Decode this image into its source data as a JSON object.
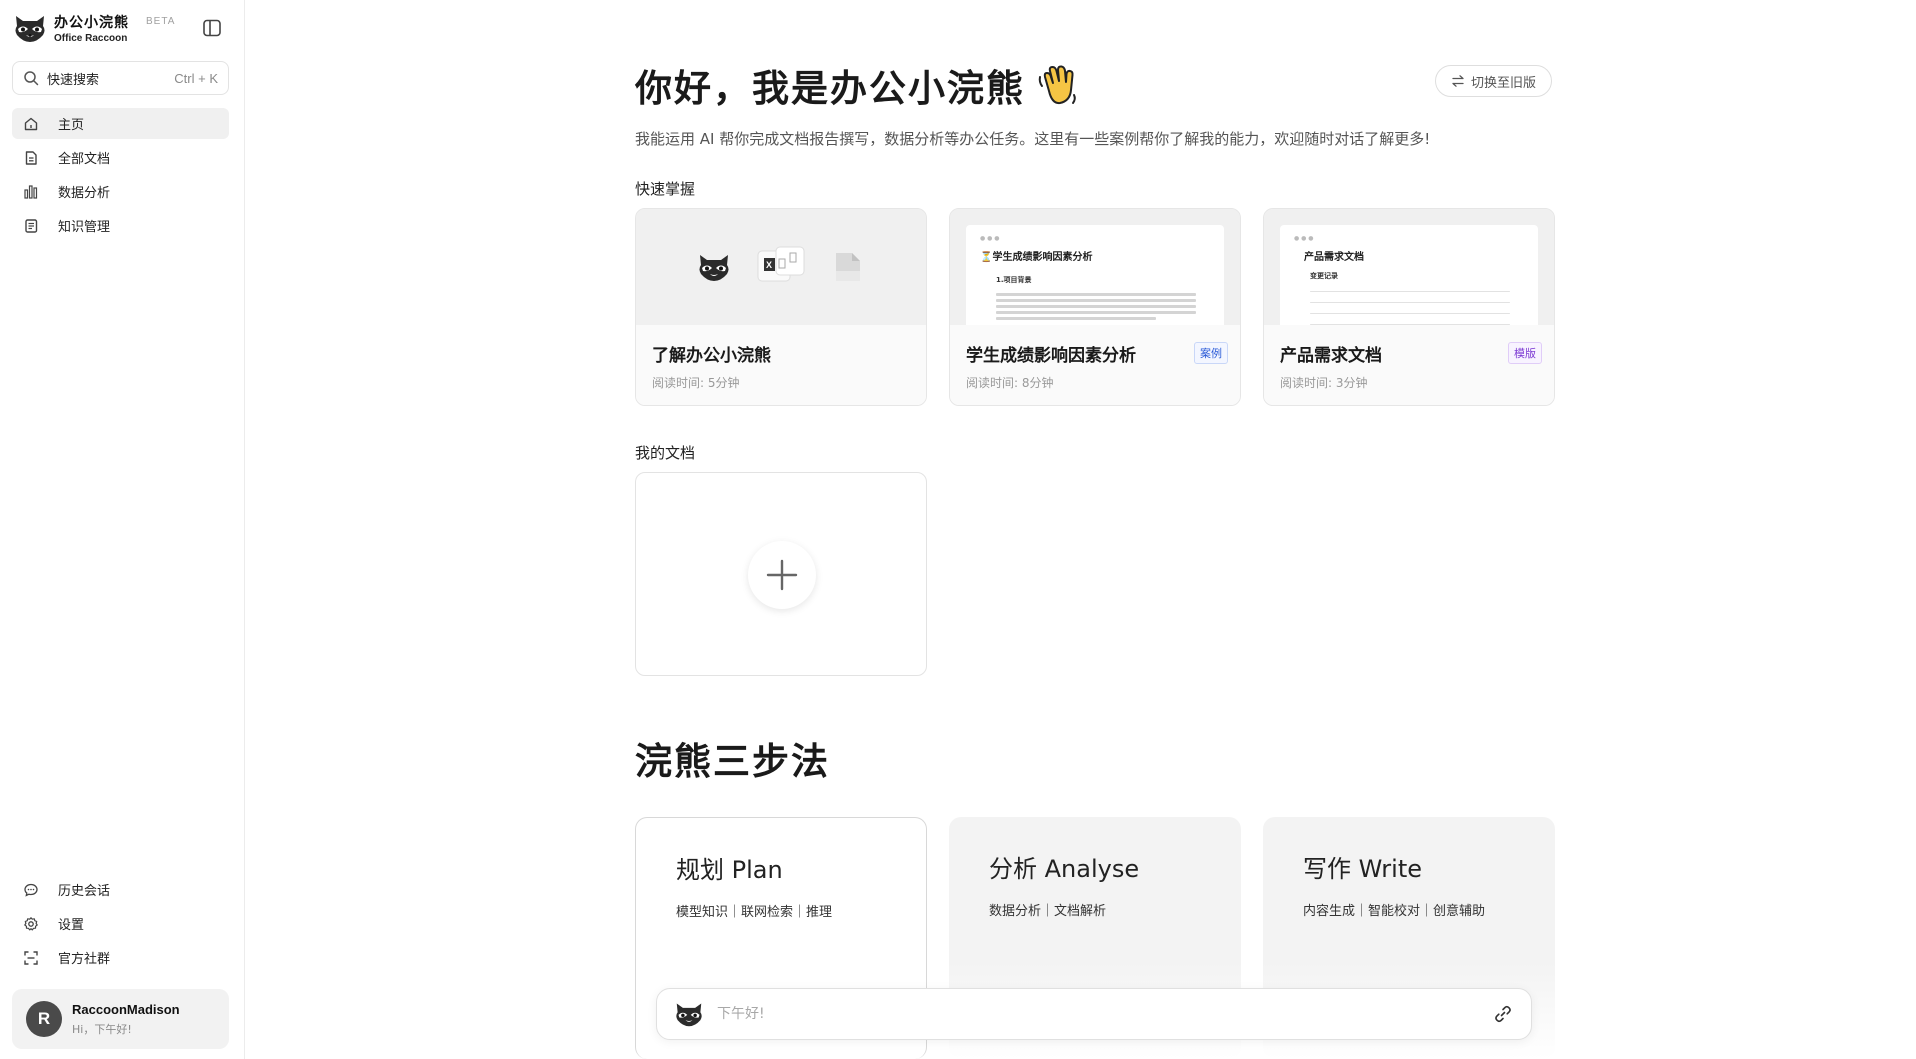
{
  "sidebar": {
    "brand_cn": "办公小浣熊",
    "brand_en": "Office Raccoon",
    "beta": "BETA",
    "search_label": "快速搜索",
    "search_hint": "Ctrl + K",
    "items": [
      {
        "label": "主页",
        "icon": "home-icon",
        "active": true
      },
      {
        "label": "全部文档",
        "icon": "document-icon"
      },
      {
        "label": "数据分析",
        "icon": "bar-chart-icon"
      },
      {
        "label": "知识管理",
        "icon": "notebook-icon"
      }
    ],
    "bottom_items": [
      {
        "label": "历史会话",
        "icon": "chat-history-icon"
      },
      {
        "label": "设置",
        "icon": "gear-icon"
      },
      {
        "label": "官方社群",
        "icon": "community-icon"
      }
    ],
    "user": {
      "initial": "R",
      "name": "RaccoonMadison",
      "greeting": "Hi，下午好!"
    }
  },
  "main": {
    "title": "你好，我是办公小浣熊",
    "switch_label": "切换至旧版",
    "subtitle": "我能运用 AI 帮你完成文档报告撰写，数据分析等办公任务。这里有一些案例帮你了解我的能力，欢迎随时对话了解更多!",
    "quick_label": "快速掌握",
    "quick_cards": [
      {
        "title": "了解办公小浣熊",
        "time": "阅读时间: 5分钟",
        "tag": ""
      },
      {
        "title": "学生成绩影响因素分析",
        "time": "阅读时间: 8分钟",
        "tag": "案例",
        "doc_title": "学生成绩影响因素分析",
        "doc_sub": "1.项目背景"
      },
      {
        "title": "产品需求文档",
        "time": "阅读时间: 3分钟",
        "tag": "模版",
        "doc_title": "产品需求文档",
        "doc_sub": "变更记录"
      }
    ],
    "my_docs_label": "我的文档",
    "steps_title": "浣熊三步法",
    "steps": [
      {
        "title": "规划 Plan",
        "desc": "模型知识｜联网检索｜推理"
      },
      {
        "title": "分析 Analyse",
        "desc": "数据分析｜文档解析"
      },
      {
        "title": "写作 Write",
        "desc": "内容生成｜智能校对｜创意辅助"
      }
    ],
    "chat_placeholder": "下午好!"
  }
}
